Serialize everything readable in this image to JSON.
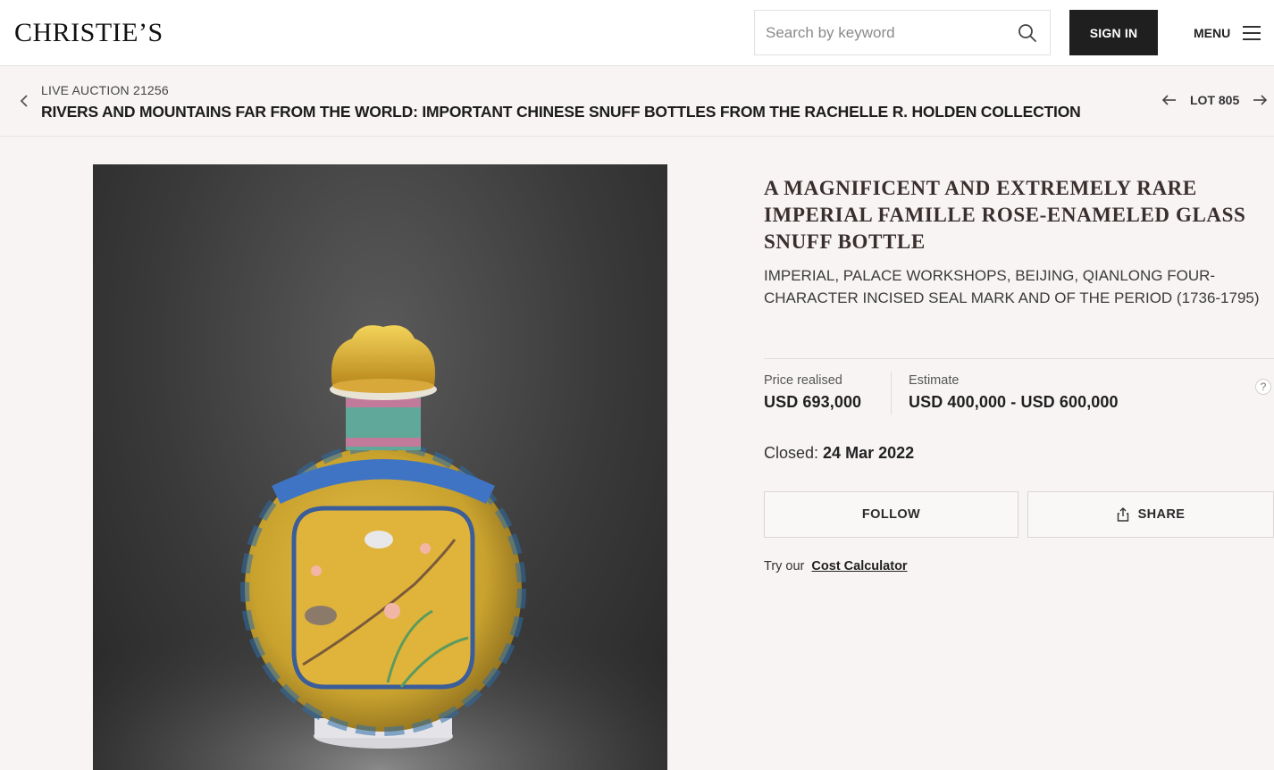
{
  "header": {
    "logo": "CHRISTIE’S",
    "search_placeholder": "Search by keyword",
    "signin_label": "SIGN IN",
    "menu_label": "MENU"
  },
  "breadcrumb": {
    "auction_number": "LIVE AUCTION 21256",
    "auction_title": "RIVERS AND MOUNTAINS FAR FROM THE WORLD: IMPORTANT CHINESE SNUFF BOTTLES FROM THE RACHELLE R. HOLDEN COLLECTION",
    "lot_label": "LOT 805"
  },
  "lot": {
    "title": "A MAGNIFICENT AND EXTREMELY RARE IMPERIAL FAMILLE ROSE-ENAMELED GLASS SNUFF BOTTLE",
    "subtitle": "IMPERIAL, PALACE WORKSHOPS, BEIJING, QIANLONG FOUR-CHARACTER INCISED SEAL MARK AND OF THE PERIOD (1736-1795)",
    "price_label": "Price realised",
    "price_value": "USD 693,000",
    "estimate_label": "Estimate",
    "estimate_value": "USD 400,000 - USD 600,000",
    "help": "?",
    "closed_label": "Closed:",
    "closed_date": "24 Mar 2022",
    "follow_label": "FOLLOW",
    "share_label": "SHARE",
    "calc_prefix": "Try our",
    "calc_link": "Cost Calculator"
  },
  "colors": {
    "accent_dark": "#1f1f1f",
    "page_bg": "#f8f4f4",
    "title_color": "#3a2f2f"
  },
  "icons": [
    "search-icon",
    "chevron-left-icon",
    "arrow-left-icon",
    "arrow-right-icon",
    "menu-icon",
    "share-icon",
    "help-icon"
  ]
}
